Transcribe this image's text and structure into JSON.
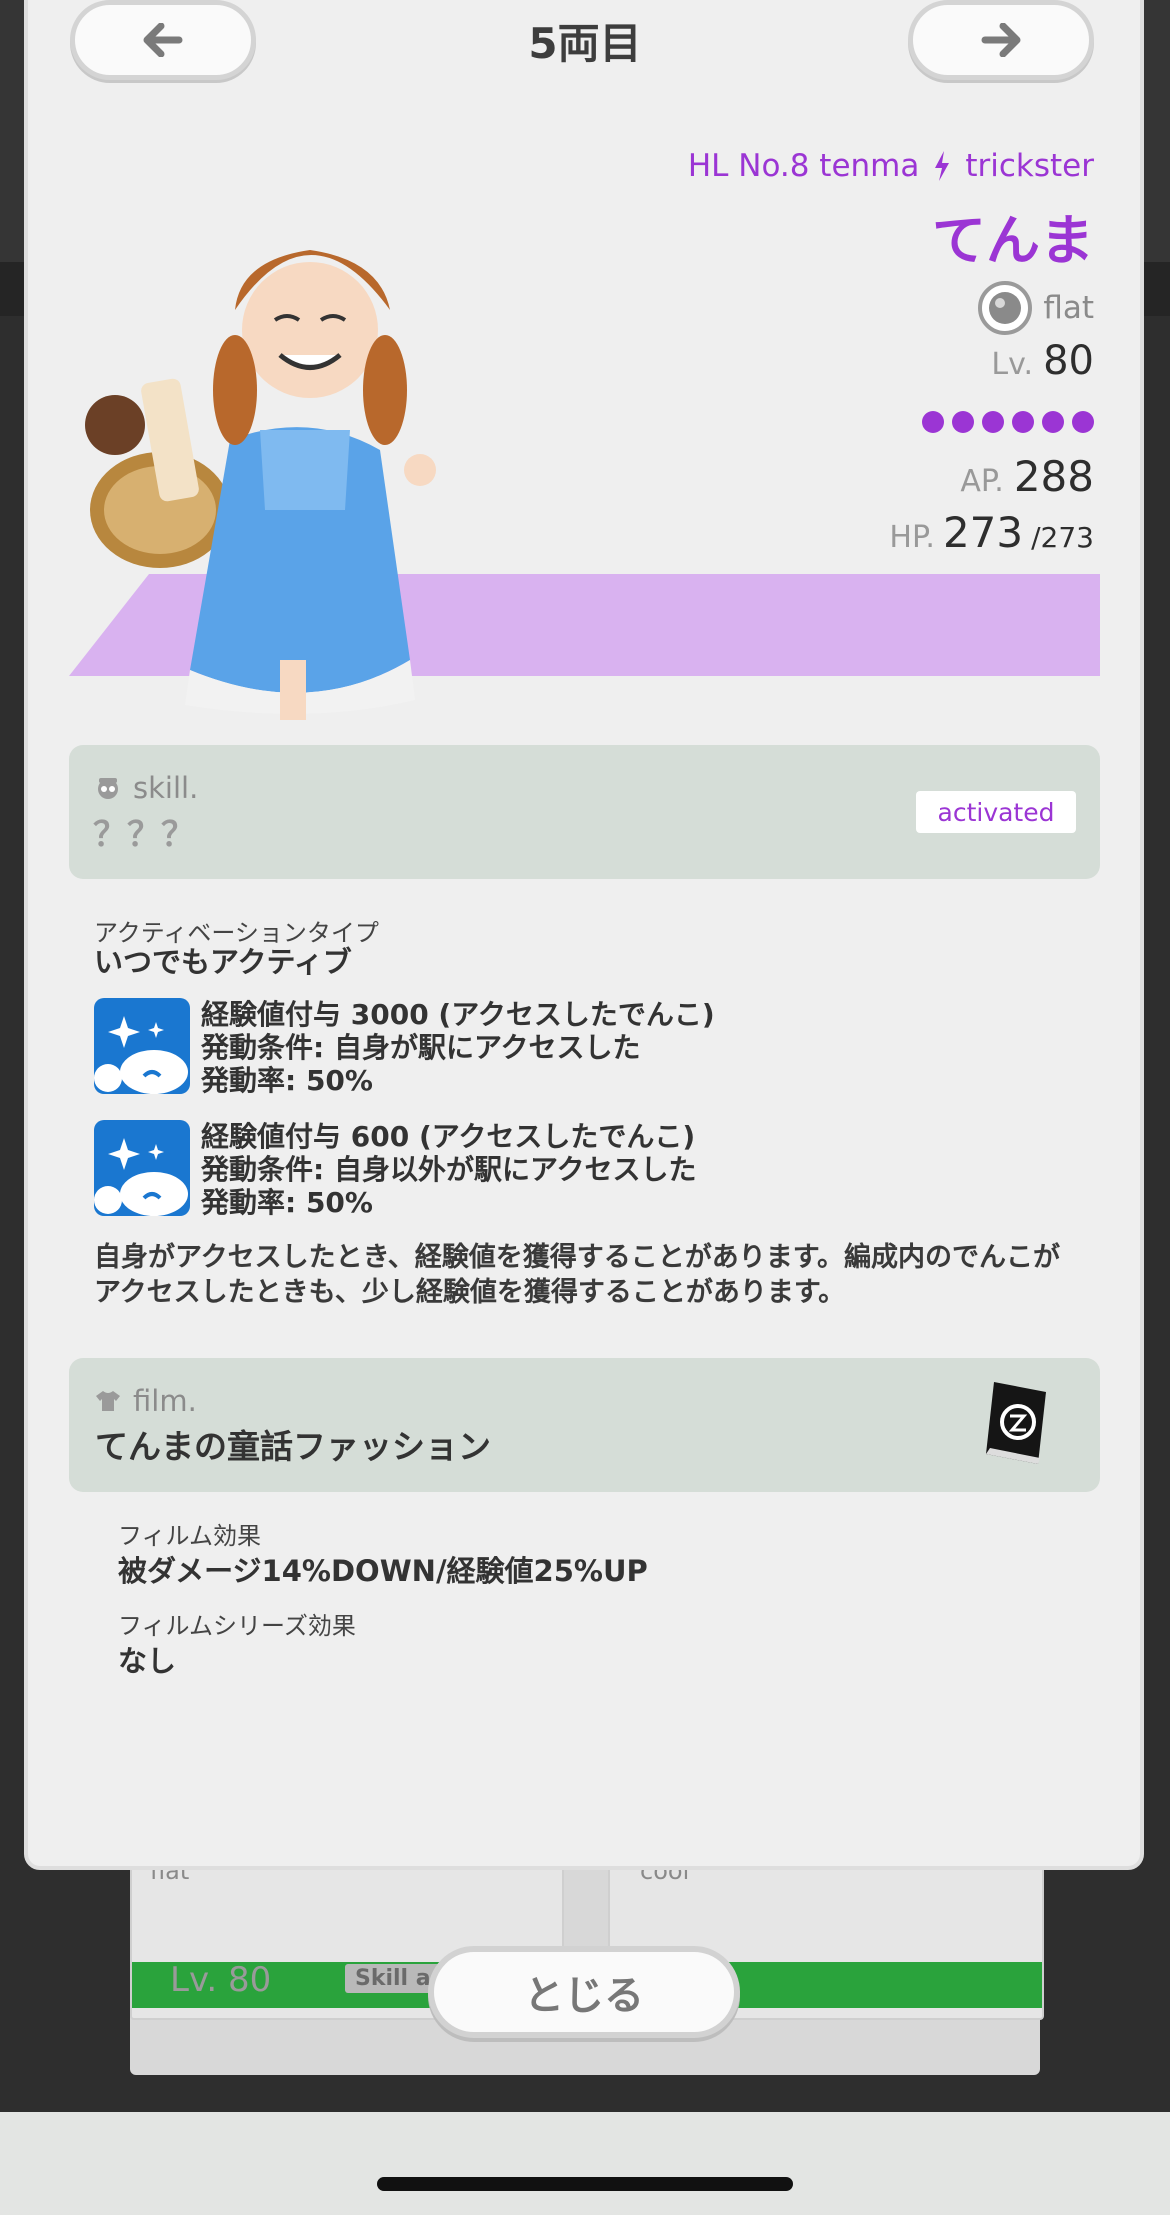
{
  "header": {
    "title": "5両目"
  },
  "character": {
    "id_line": "HL No.8 tenma",
    "type": "trickster",
    "name": "てんま",
    "attribute": "flat",
    "level_label": "Lv.",
    "level": "80",
    "rarity_dots": 6,
    "ap_label": "AP.",
    "ap": "288",
    "hp_label": "HP.",
    "hp": "273",
    "hp_max": "/273",
    "theme_color": "#9b35d4",
    "band_color": "#d9b2f0"
  },
  "skill": {
    "label": "skill.",
    "name": "？？？",
    "badge": "activated",
    "activation_label": "アクティベーションタイプ",
    "activation_value": "いつでもアクティブ",
    "effects": [
      {
        "line1": "経験値付与 3000 (アクセスしたでんこ)",
        "line2": "発動条件: 自身が駅にアクセスした",
        "line3": "発動率: 50%"
      },
      {
        "line1": "経験値付与 600 (アクセスしたでんこ)",
        "line2": "発動条件: 自身以外が駅にアクセスした",
        "line3": "発動率: 50%"
      }
    ],
    "description": "自身がアクセスしたとき、経験値を獲得することがあります。編成内のでんこがアクセスしたときも、少し経験値を獲得することがあります。"
  },
  "film": {
    "label": "film.",
    "name": "てんまの童話ファッション",
    "effect_label": "フィルム効果",
    "effect_value": "被ダメージ14%DOWN/経験値25%UP",
    "series_label": "フィルムシリーズ効果",
    "series_value": "なし"
  },
  "close_label": "とじる",
  "background": {
    "left_attr": "flat",
    "right_attr": "cool",
    "lv": "Lv. 80",
    "skill": "Skill a"
  }
}
